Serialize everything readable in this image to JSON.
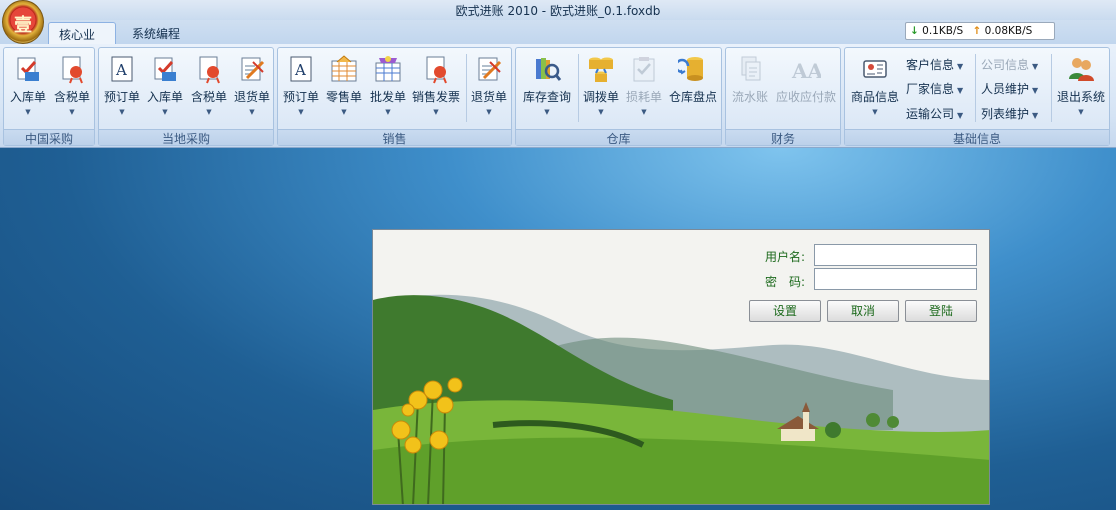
{
  "window": {
    "title": "欧式进账 2010 - 欧式进账_0.1.foxdb",
    "logo_text": "壹"
  },
  "tabs": [
    {
      "label": "核心业务"
    },
    {
      "label": "系统编程"
    }
  ],
  "network": {
    "down": "0.1KB/S",
    "up": "0.08KB/S"
  },
  "ribbon": {
    "groups": [
      {
        "label": "中国采购",
        "buttons": [
          {
            "label": "入库单"
          },
          {
            "label": "含税单"
          }
        ]
      },
      {
        "label": "当地采购",
        "buttons": [
          {
            "label": "预订单"
          },
          {
            "label": "入库单"
          },
          {
            "label": "含税单"
          },
          {
            "label": "退货单"
          }
        ]
      },
      {
        "label": "销售",
        "buttons": [
          {
            "label": "预订单"
          },
          {
            "label": "零售单"
          },
          {
            "label": "批发单"
          },
          {
            "label": "销售发票"
          },
          {
            "label": "退货单"
          }
        ]
      },
      {
        "label": "仓库",
        "buttons": [
          {
            "label": "库存查询"
          },
          {
            "label": "调拨单"
          },
          {
            "label": "损耗单"
          },
          {
            "label": "仓库盘点"
          }
        ]
      },
      {
        "label": "财务",
        "buttons": [
          {
            "label": "流水账"
          },
          {
            "label": "应收应付款"
          }
        ]
      },
      {
        "label": "基础信息",
        "buttons": [
          {
            "label": "商品信息"
          },
          {
            "label": "客户信息"
          },
          {
            "label": "厂家信息"
          },
          {
            "label": "运输公司"
          },
          {
            "label": "公司信息"
          },
          {
            "label": "人员维护"
          },
          {
            "label": "列表维护"
          },
          {
            "label": "退出系统"
          }
        ]
      }
    ]
  },
  "login": {
    "username_label": "用户名:",
    "password_label": "密　码:",
    "username_value": "",
    "password_value": "",
    "settings_label": "设置",
    "cancel_label": "取消",
    "login_label": "登陆"
  }
}
